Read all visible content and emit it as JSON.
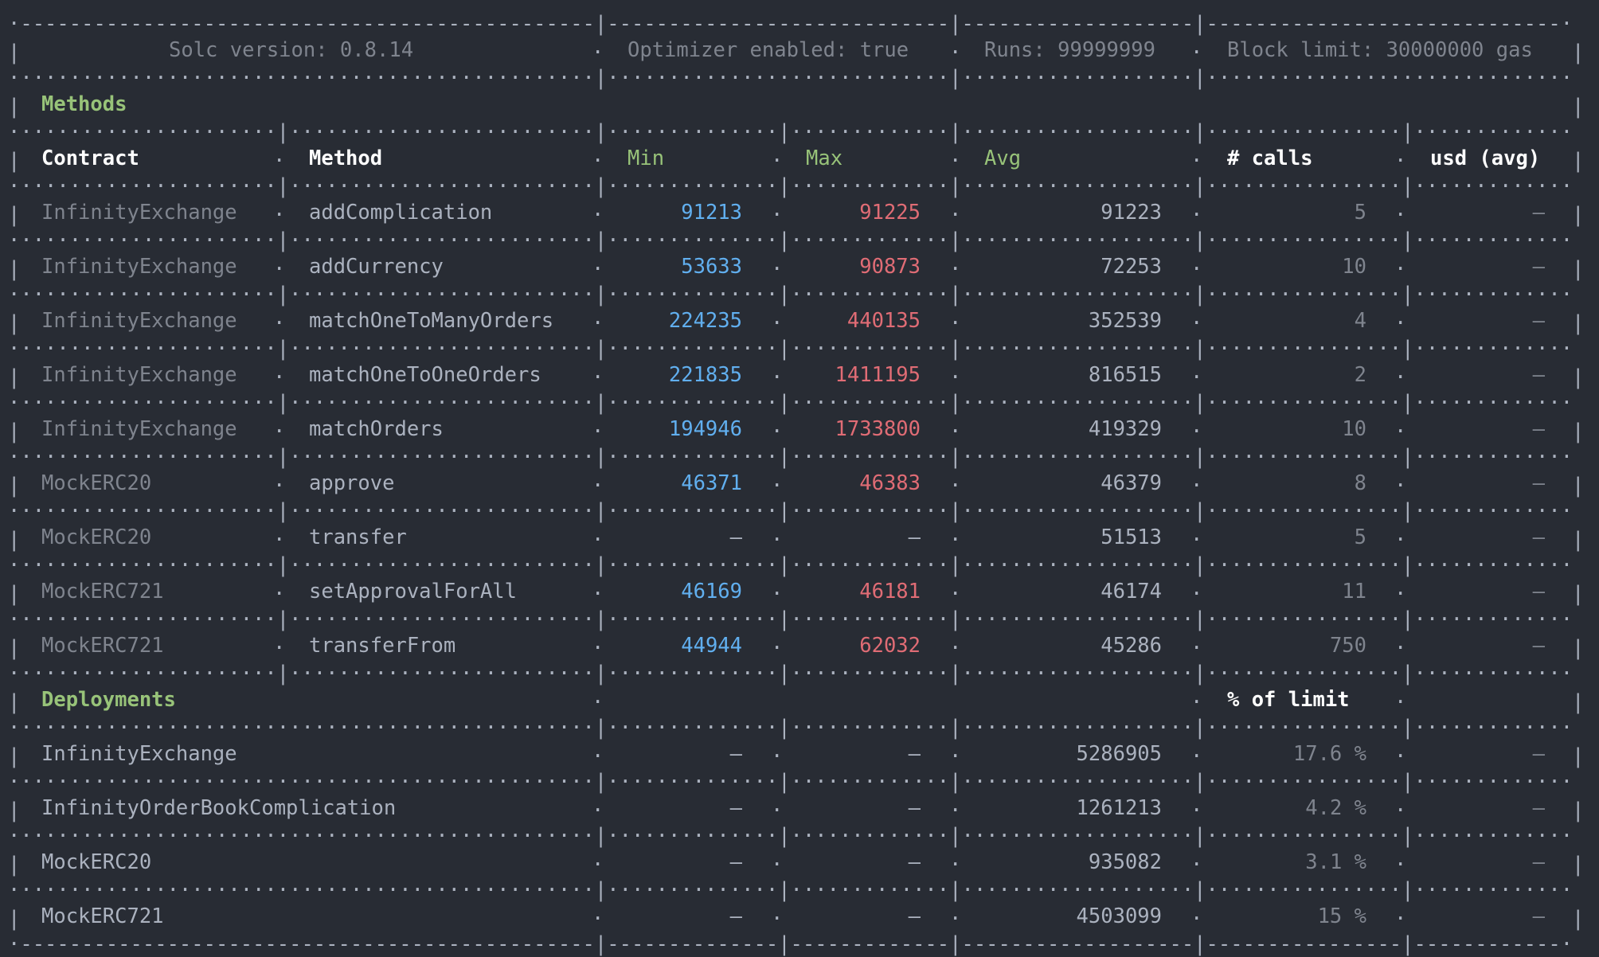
{
  "config": {
    "solc": "Solc version: 0.8.14",
    "optimizer": "Optimizer enabled: true",
    "runs": "Runs: 99999999",
    "block_limit": "Block limit: 30000000 gas"
  },
  "methods_section": {
    "title": "Methods",
    "headers": {
      "contract": "Contract",
      "method": "Method",
      "min": "Min",
      "max": "Max",
      "avg": "Avg",
      "calls": "# calls",
      "usd": "usd (avg)"
    },
    "rows": [
      {
        "contract": "InfinityExchange",
        "method": "addComplication",
        "min": "91213",
        "max": "91225",
        "avg": "91223",
        "calls": "5",
        "usd": "-"
      },
      {
        "contract": "InfinityExchange",
        "method": "addCurrency",
        "min": "53633",
        "max": "90873",
        "avg": "72253",
        "calls": "10",
        "usd": "-"
      },
      {
        "contract": "InfinityExchange",
        "method": "matchOneToManyOrders",
        "min": "224235",
        "max": "440135",
        "avg": "352539",
        "calls": "4",
        "usd": "-"
      },
      {
        "contract": "InfinityExchange",
        "method": "matchOneToOneOrders",
        "min": "221835",
        "max": "1411195",
        "avg": "816515",
        "calls": "2",
        "usd": "-"
      },
      {
        "contract": "InfinityExchange",
        "method": "matchOrders",
        "min": "194946",
        "max": "1733800",
        "avg": "419329",
        "calls": "10",
        "usd": "-"
      },
      {
        "contract": "MockERC20",
        "method": "approve",
        "min": "46371",
        "max": "46383",
        "avg": "46379",
        "calls": "8",
        "usd": "-"
      },
      {
        "contract": "MockERC20",
        "method": "transfer",
        "min": "-",
        "max": "-",
        "avg": "51513",
        "calls": "5",
        "usd": "-"
      },
      {
        "contract": "MockERC721",
        "method": "setApprovalForAll",
        "min": "46169",
        "max": "46181",
        "avg": "46174",
        "calls": "11",
        "usd": "-"
      },
      {
        "contract": "MockERC721",
        "method": "transferFrom",
        "min": "44944",
        "max": "62032",
        "avg": "45286",
        "calls": "750",
        "usd": "-"
      }
    ]
  },
  "deployments_section": {
    "title": "Deployments",
    "limit_header": "% of limit",
    "rows": [
      {
        "contract": "InfinityExchange",
        "min": "-",
        "max": "-",
        "avg": "5286905",
        "pct": "17.6 %",
        "usd": "-"
      },
      {
        "contract": "InfinityOrderBookComplication",
        "min": "-",
        "max": "-",
        "avg": "1261213",
        "pct": "4.2 %",
        "usd": "-"
      },
      {
        "contract": "MockERC20",
        "min": "-",
        "max": "-",
        "avg": "935082",
        "pct": "3.1 %",
        "usd": "-"
      },
      {
        "contract": "MockERC721",
        "min": "-",
        "max": "-",
        "avg": "4503099",
        "pct": "15 %",
        "usd": "-"
      }
    ]
  }
}
